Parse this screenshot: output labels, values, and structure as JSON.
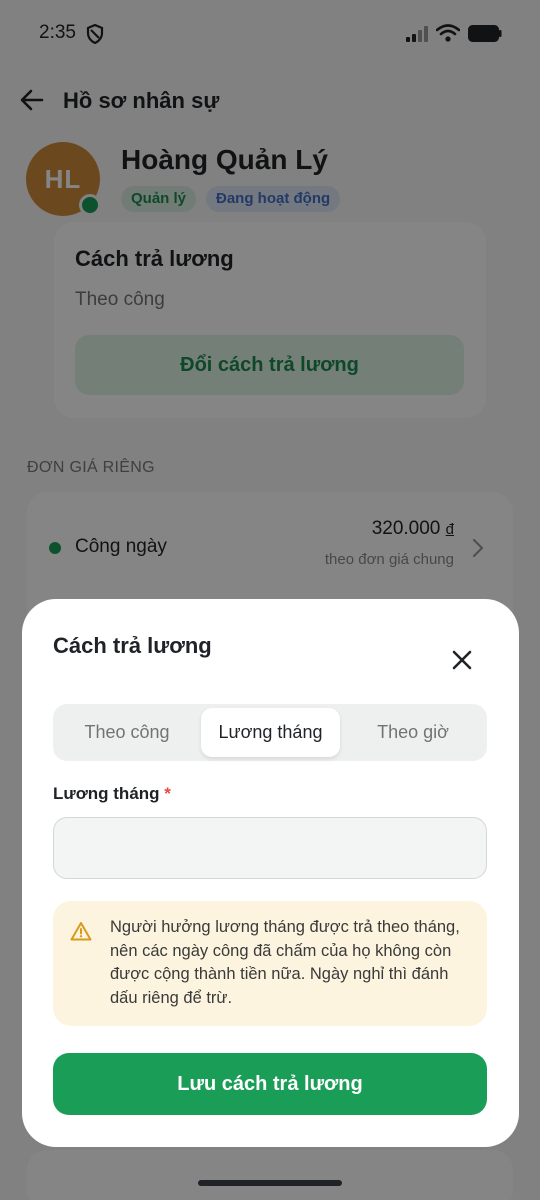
{
  "status_bar": {
    "time": "2:35"
  },
  "header": {
    "title": "Hồ sơ nhân sự"
  },
  "profile": {
    "initials": "HL",
    "name": "Hoàng Quản Lý",
    "role_badge": "Quản lý",
    "status_badge": "Đang hoạt động"
  },
  "pay_card": {
    "title": "Cách trả lương",
    "value": "Theo công",
    "change_button": "Đổi cách trả lương"
  },
  "rates_section": {
    "label": "ĐƠN GIÁ RIÊNG",
    "items": [
      {
        "name": "Công ngày",
        "amount": "320.000",
        "unit": "đ",
        "sub": "theo đơn giá chung"
      }
    ]
  },
  "sheet": {
    "title": "Cách trả lương",
    "tabs": [
      "Theo công",
      "Lương tháng",
      "Theo giờ"
    ],
    "selected_tab": "Lương tháng",
    "field_label": "Lương tháng",
    "field_required_mark": "*",
    "field_value": "",
    "alert_text": "Người hưởng lương tháng được trả theo tháng, nên các ngày công đã chấm của họ không còn được cộng thành tiền nữa. Ngày nghỉ thì đánh dấu riêng để trừ.",
    "save_button": "Lưu cách trả lương"
  },
  "icons": {
    "back": "arrow-left-icon",
    "close": "close-icon",
    "warning": "warning-triangle-icon",
    "chevron": "chevron-right-icon"
  },
  "colors": {
    "accent": "#1a9e57",
    "avatar": "#d08a3c",
    "role_badge_bg": "#dbeee3",
    "status_badge_bg": "#dde7f7",
    "alert_bg": "#fdf4e0",
    "required": "#e5483f"
  }
}
